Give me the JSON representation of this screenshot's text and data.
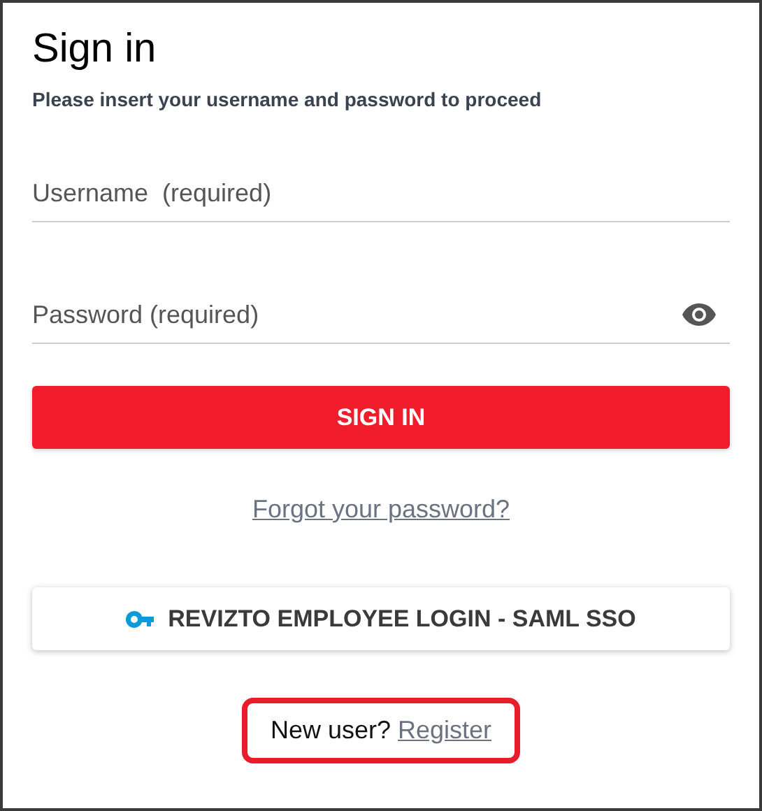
{
  "title": "Sign in",
  "subtitle": "Please insert your username and password to proceed",
  "fields": [
    {
      "kind": "text",
      "placeholder": "Username  (required)"
    },
    {
      "kind": "password",
      "placeholder": "Password (required)"
    }
  ],
  "sign_in_button": "SIGN IN",
  "forgot_link": "Forgot your password?",
  "sso_button": "REVIZTO EMPLOYEE LOGIN - SAML SSO",
  "register": {
    "prompt": "New user?",
    "link": "Register",
    "highlighted": true
  }
}
